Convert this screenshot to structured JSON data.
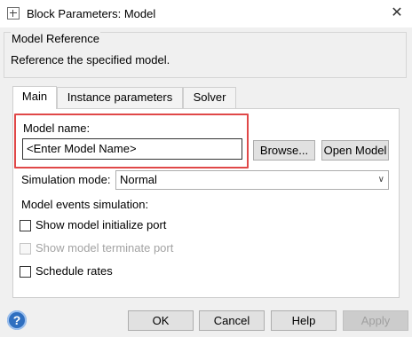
{
  "window": {
    "title": "Block Parameters: Model",
    "close_glyph": "✕"
  },
  "group": {
    "title": "Model Reference",
    "description": "Reference the specified model."
  },
  "tabs": [
    {
      "label": "Main",
      "active": true
    },
    {
      "label": "Instance parameters",
      "active": false
    },
    {
      "label": "Solver",
      "active": false
    }
  ],
  "main": {
    "model_name_label": "Model name:",
    "model_name_value": "<Enter Model Name>",
    "browse_button": "Browse...",
    "open_model_button": "Open Model",
    "simulation_mode_label": "Simulation mode:",
    "simulation_mode_value": "Normal",
    "model_events_label": "Model events simulation:",
    "checkboxes": {
      "initialize_port": {
        "label": "Show model initialize port",
        "checked": false,
        "enabled": true
      },
      "terminate_port": {
        "label": "Show model terminate port",
        "checked": false,
        "enabled": false
      },
      "schedule_rates": {
        "label": "Schedule rates",
        "checked": false,
        "enabled": true
      }
    }
  },
  "footer": {
    "ok": "OK",
    "cancel": "Cancel",
    "help": "Help",
    "apply": "Apply",
    "help_glyph": "?"
  },
  "colors": {
    "highlight_border": "#e04848",
    "help_icon": "#2f6fc0"
  }
}
